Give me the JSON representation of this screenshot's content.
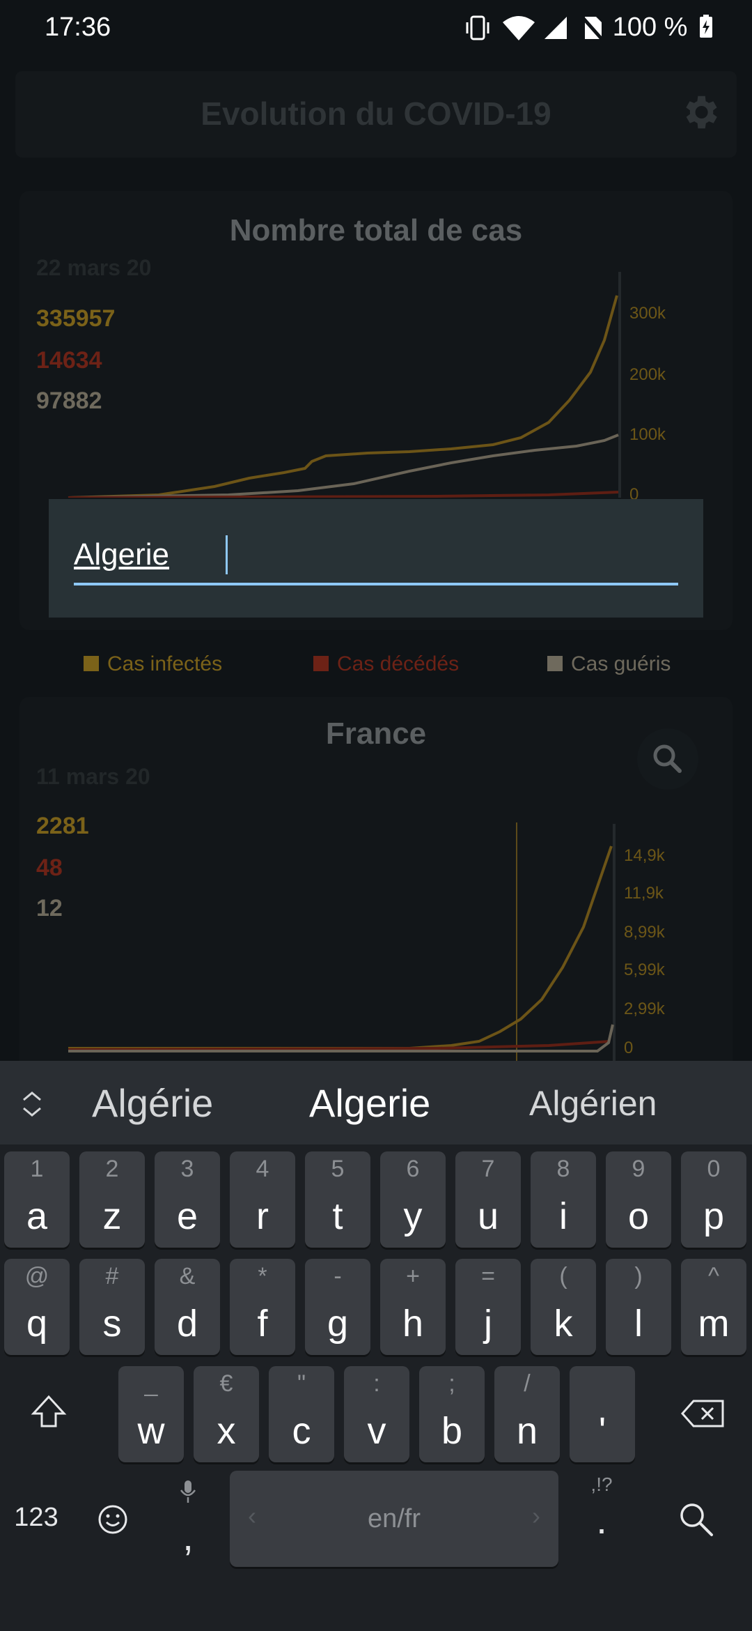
{
  "status_bar": {
    "time": "17:36",
    "battery": "100 %"
  },
  "header": {
    "title": "Evolution du COVID-19"
  },
  "total_card": {
    "title": "Nombre total de cas",
    "date": "22 mars 20",
    "infected": "335957",
    "deaths": "14634",
    "recovered": "97882",
    "y_ticks": [
      "300k",
      "200k",
      "100k",
      "0"
    ]
  },
  "legend": {
    "infected": "Cas infectés",
    "deaths": "Cas décédés",
    "recovered": "Cas guéris"
  },
  "country_card": {
    "title": "France",
    "date": "11 mars 20",
    "infected": "2281",
    "deaths": "48",
    "recovered": "12",
    "y_ticks": [
      "14,9k",
      "11,9k",
      "8,99k",
      "5,99k",
      "2,99k",
      "0"
    ]
  },
  "search": {
    "value": "Algerie"
  },
  "keyboard": {
    "suggestions": [
      "Algérie",
      "Algerie",
      "Algérien"
    ],
    "row1": [
      {
        "k": "a",
        "h": "1"
      },
      {
        "k": "z",
        "h": "2"
      },
      {
        "k": "e",
        "h": "3"
      },
      {
        "k": "r",
        "h": "4"
      },
      {
        "k": "t",
        "h": "5"
      },
      {
        "k": "y",
        "h": "6"
      },
      {
        "k": "u",
        "h": "7"
      },
      {
        "k": "i",
        "h": "8"
      },
      {
        "k": "o",
        "h": "9"
      },
      {
        "k": "p",
        "h": "0"
      }
    ],
    "row2": [
      {
        "k": "q",
        "h": "@"
      },
      {
        "k": "s",
        "h": "#"
      },
      {
        "k": "d",
        "h": "&"
      },
      {
        "k": "f",
        "h": "*"
      },
      {
        "k": "g",
        "h": "-"
      },
      {
        "k": "h",
        "h": "+"
      },
      {
        "k": "j",
        "h": "="
      },
      {
        "k": "k",
        "h": "("
      },
      {
        "k": "l",
        "h": ")"
      },
      {
        "k": "m",
        "h": "^"
      }
    ],
    "row3": [
      {
        "k": "w",
        "h": "_"
      },
      {
        "k": "x",
        "h": "€"
      },
      {
        "k": "c",
        "h": "\""
      },
      {
        "k": "v",
        "h": ":"
      },
      {
        "k": "b",
        "h": ";"
      },
      {
        "k": "n",
        "h": "/"
      },
      {
        "k": "'",
        "h": ""
      }
    ],
    "numbers_key": "123",
    "comma_key": ",",
    "space_label": "en/fr",
    "period_key": ".",
    "period_hint": ",!?"
  },
  "colors": {
    "infected": "#7b6219",
    "deaths": "#6d2216",
    "recovered": "#6f6a5d",
    "accent": "#8ec8f6"
  }
}
